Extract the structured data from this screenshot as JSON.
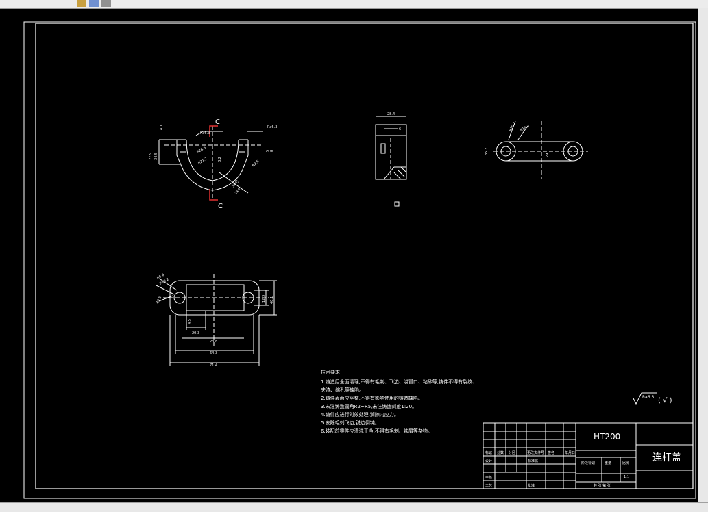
{
  "drawing": {
    "section_label": "C",
    "dimensions": {
      "main_view": [
        "4.1",
        "27.9",
        "34.5",
        "R28.6",
        "R21.7",
        "8.2",
        "R8.6",
        "Ra6.3",
        "Ra6.3",
        "3X45",
        "2X45",
        "5",
        "8"
      ],
      "side_view": [
        "28.4",
        "6"
      ],
      "top_right_view": [
        "R10.2",
        "R14.3",
        "35.2",
        "29.1"
      ],
      "bottom_view": [
        "R8.6",
        "R10.2",
        "R0.5",
        "4.5",
        "20.3",
        "12.3",
        "23.8",
        "40.1",
        "64.3",
        "71.4"
      ]
    }
  },
  "tech_req": {
    "title": "技术要求",
    "lines": [
      "1.铸造后全面清理,不得有毛刺、飞边、浇冒口、粘砂等,铸件不得有裂纹、",
      "夹渣、缩孔等缺陷。",
      "2.铸件表面应平整,不得有影响使用的铸造缺陷。",
      "3.未注铸造圆角R2~R5,未注铸造斜度1:20。",
      "4.铸件应进行时效处理,消除内应力。",
      "5.去除毛刺飞边,锐边倒钝。",
      "6.装配前零件应清洗干净,不得有毛刺、铁屑等杂物。"
    ]
  },
  "roughness": {
    "label": "Ra6.3",
    "rest": "( √ )"
  },
  "title_block": {
    "material": "HT200",
    "part_name": "连杆盖",
    "labels": [
      "标记",
      "处数",
      "分区",
      "更改文件号",
      "签名",
      "年月日",
      "设计",
      "标准化",
      "审核",
      "工艺",
      "阶段标记",
      "重量",
      "比例",
      "批准"
    ],
    "scale": "1:1",
    "sheet": "共 张 第 张"
  }
}
